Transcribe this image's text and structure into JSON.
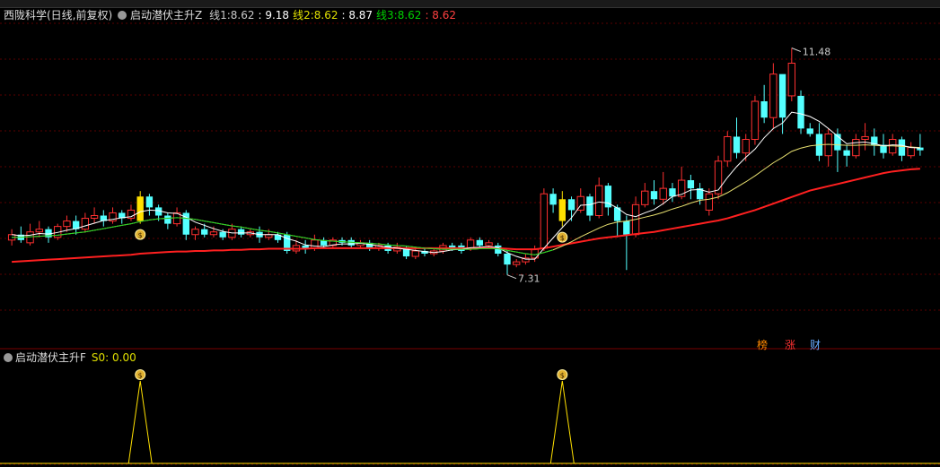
{
  "stock": "西陇科学(日线,前复权)",
  "indicator": "启动潜伏主升Z",
  "lines": [
    {
      "label": "线1:",
      "value": "8.62",
      "color": "#c8c8c8"
    },
    {
      "label": "",
      "value": "9.18",
      "color": "#ffffff"
    },
    {
      "label": "线2:",
      "value": "8.62",
      "color": "#e0e000"
    },
    {
      "label": "",
      "value": "8.87",
      "color": "#ffffff"
    },
    {
      "label": "线3:",
      "value": "8.62",
      "color": "#00d000"
    },
    {
      "label": "",
      "value": "8.62",
      "color": "#ff4040"
    }
  ],
  "sub_indicator": "启动潜伏主升F",
  "sub_value": "S0: 0.00",
  "tags": [
    {
      "text": "榜",
      "color": "#ff8800"
    },
    {
      "text": "涨",
      "color": "#ff3333"
    },
    {
      "text": "财",
      "color": "#66aaff"
    }
  ],
  "chart_data": {
    "type": "candlestick",
    "ylim": [
      6.3,
      11.9
    ],
    "high_label": "11.48",
    "low_label": "7.31",
    "signal_days": [
      14,
      60
    ],
    "candles": [
      [
        7.95,
        8.05,
        8.15,
        7.85
      ],
      [
        8.05,
        7.95,
        8.2,
        7.9
      ],
      [
        7.9,
        8.1,
        8.25,
        7.85
      ],
      [
        8.1,
        8.15,
        8.3,
        8.0
      ],
      [
        8.15,
        8.0,
        8.2,
        7.9
      ],
      [
        8.0,
        8.2,
        8.25,
        7.95
      ],
      [
        8.2,
        8.3,
        8.4,
        8.1
      ],
      [
        8.3,
        8.15,
        8.4,
        8.05
      ],
      [
        8.15,
        8.35,
        8.45,
        8.1
      ],
      [
        8.35,
        8.4,
        8.55,
        8.25
      ],
      [
        8.4,
        8.3,
        8.5,
        8.2
      ],
      [
        8.3,
        8.45,
        8.55,
        8.25
      ],
      [
        8.45,
        8.35,
        8.5,
        8.25
      ],
      [
        8.35,
        8.5,
        8.6,
        8.3
      ],
      [
        8.3,
        8.75,
        8.85,
        8.25
      ],
      [
        8.75,
        8.55,
        8.8,
        8.4
      ],
      [
        8.55,
        8.4,
        8.6,
        8.3
      ],
      [
        8.4,
        8.25,
        8.45,
        8.15
      ],
      [
        8.25,
        8.45,
        8.55,
        8.2
      ],
      [
        8.45,
        8.05,
        8.5,
        7.95
      ],
      [
        8.05,
        8.15,
        8.2,
        7.95
      ],
      [
        8.15,
        8.05,
        8.25,
        8.0
      ],
      [
        8.05,
        8.1,
        8.2,
        8.0
      ],
      [
        8.1,
        8.0,
        8.15,
        7.95
      ],
      [
        8.0,
        8.15,
        8.25,
        7.95
      ],
      [
        8.15,
        8.05,
        8.2,
        8.0
      ],
      [
        8.05,
        8.1,
        8.15,
        8.0
      ],
      [
        8.1,
        8.0,
        8.2,
        7.9
      ],
      [
        8.0,
        8.05,
        8.15,
        7.95
      ],
      [
        8.05,
        7.95,
        8.1,
        7.9
      ],
      [
        8.05,
        7.75,
        8.1,
        7.7
      ],
      [
        7.75,
        7.85,
        7.95,
        7.7
      ],
      [
        7.85,
        7.8,
        7.95,
        7.7
      ],
      [
        7.8,
        7.95,
        8.05,
        7.75
      ],
      [
        7.95,
        7.85,
        8.0,
        7.8
      ],
      [
        7.85,
        7.95,
        8.0,
        7.8
      ],
      [
        7.95,
        7.9,
        8.0,
        7.85
      ],
      [
        7.95,
        7.85,
        8.0,
        7.8
      ],
      [
        7.85,
        7.9,
        7.95,
        7.8
      ],
      [
        7.9,
        7.8,
        7.95,
        7.75
      ],
      [
        7.8,
        7.85,
        7.9,
        7.75
      ],
      [
        7.85,
        7.75,
        7.9,
        7.7
      ],
      [
        7.75,
        7.82,
        7.9,
        7.7
      ],
      [
        7.8,
        7.65,
        7.85,
        7.6
      ],
      [
        7.65,
        7.75,
        7.8,
        7.6
      ],
      [
        7.75,
        7.7,
        7.8,
        7.65
      ],
      [
        7.7,
        7.75,
        7.8,
        7.65
      ],
      [
        7.75,
        7.85,
        7.9,
        7.7
      ],
      [
        7.85,
        7.8,
        7.9,
        7.75
      ],
      [
        7.85,
        7.75,
        7.9,
        7.7
      ],
      [
        7.8,
        7.95,
        8.0,
        7.75
      ],
      [
        7.95,
        7.85,
        8.0,
        7.8
      ],
      [
        7.85,
        7.9,
        7.95,
        7.8
      ],
      [
        7.85,
        7.7,
        7.9,
        7.65
      ],
      [
        7.7,
        7.5,
        7.75,
        7.31
      ],
      [
        7.5,
        7.55,
        7.6,
        7.45
      ],
      [
        7.55,
        7.62,
        7.7,
        7.5
      ],
      [
        7.62,
        7.78,
        7.85,
        7.55
      ],
      [
        7.8,
        8.8,
        8.9,
        7.75
      ],
      [
        8.8,
        8.6,
        8.9,
        8.45
      ],
      [
        8.3,
        8.7,
        8.85,
        8.2
      ],
      [
        8.7,
        8.5,
        8.75,
        8.3
      ],
      [
        8.5,
        8.75,
        8.9,
        8.45
      ],
      [
        8.75,
        8.4,
        8.8,
        8.3
      ],
      [
        8.4,
        8.95,
        9.1,
        8.35
      ],
      [
        8.95,
        8.55,
        9.0,
        8.4
      ],
      [
        8.55,
        8.3,
        8.6,
        8.0
      ],
      [
        8.3,
        8.05,
        8.4,
        7.4
      ],
      [
        8.05,
        8.6,
        8.75,
        8.0
      ],
      [
        8.6,
        8.85,
        9.0,
        8.55
      ],
      [
        8.85,
        8.7,
        9.05,
        8.6
      ],
      [
        8.7,
        8.9,
        9.2,
        8.6
      ],
      [
        8.9,
        8.75,
        9.0,
        8.65
      ],
      [
        8.75,
        9.05,
        9.3,
        8.7
      ],
      [
        9.05,
        8.9,
        9.15,
        8.7
      ],
      [
        8.9,
        8.7,
        9.0,
        8.6
      ],
      [
        8.5,
        8.8,
        8.9,
        8.4
      ],
      [
        8.8,
        9.4,
        9.5,
        8.7
      ],
      [
        9.4,
        9.85,
        9.95,
        9.3
      ],
      [
        9.85,
        9.55,
        10.2,
        9.45
      ],
      [
        9.55,
        9.8,
        9.9,
        9.4
      ],
      [
        9.8,
        10.5,
        10.6,
        9.7
      ],
      [
        10.5,
        10.2,
        10.8,
        10.1
      ],
      [
        10.2,
        11.0,
        11.2,
        10.0
      ],
      [
        11.0,
        10.2,
        10.3,
        9.9
      ],
      [
        10.6,
        11.2,
        11.48,
        10.5
      ],
      [
        10.6,
        10.0,
        10.7,
        9.9
      ],
      [
        10.0,
        9.9,
        10.1,
        9.85
      ],
      [
        9.9,
        9.5,
        10.1,
        9.4
      ],
      [
        9.5,
        9.9,
        10.0,
        9.3
      ],
      [
        9.9,
        9.6,
        10.0,
        9.2
      ],
      [
        9.6,
        9.5,
        9.7,
        9.3
      ],
      [
        9.5,
        9.8,
        9.9,
        9.45
      ],
      [
        9.8,
        9.85,
        10.1,
        9.6
      ],
      [
        9.85,
        9.7,
        10.0,
        9.5
      ],
      [
        9.7,
        9.55,
        9.9,
        9.45
      ],
      [
        9.55,
        9.8,
        9.9,
        9.5
      ],
      [
        9.8,
        9.5,
        9.85,
        9.4
      ],
      [
        9.5,
        9.65,
        9.75,
        9.45
      ],
      [
        9.65,
        9.6,
        9.9,
        9.5
      ]
    ],
    "line_ma_fast": [
      8.05,
      8.03,
      8.04,
      8.07,
      8.06,
      8.09,
      8.13,
      8.16,
      8.21,
      8.26,
      8.31,
      8.33,
      8.36,
      8.38,
      8.47,
      8.5,
      8.49,
      8.45,
      8.44,
      8.37,
      8.28,
      8.22,
      8.16,
      8.11,
      8.08,
      8.08,
      8.08,
      8.05,
      8.05,
      8.05,
      7.98,
      7.93,
      7.86,
      7.84,
      7.83,
      7.86,
      7.88,
      7.88,
      7.89,
      7.87,
      7.84,
      7.82,
      7.8,
      7.78,
      7.76,
      7.74,
      7.72,
      7.74,
      7.77,
      7.78,
      7.81,
      7.82,
      7.83,
      7.81,
      7.72,
      7.65,
      7.6,
      7.6,
      7.8,
      7.99,
      8.18,
      8.36,
      8.59,
      8.6,
      8.65,
      8.63,
      8.54,
      8.42,
      8.38,
      8.45,
      8.51,
      8.62,
      8.75,
      8.79,
      8.87,
      8.88,
      8.83,
      8.87,
      9.1,
      9.3,
      9.47,
      9.62,
      9.83,
      10.0,
      10.1,
      10.3,
      10.27,
      10.22,
      10.13,
      10.0,
      9.86,
      9.72,
      9.74,
      9.75,
      9.72,
      9.68,
      9.7,
      9.69,
      9.65,
      9.64
    ],
    "line_ma_slow": [
      8.0,
      8.0,
      8.01,
      8.02,
      8.03,
      8.04,
      8.06,
      8.08,
      8.1,
      8.13,
      8.16,
      8.19,
      8.22,
      8.25,
      8.29,
      8.32,
      8.34,
      8.35,
      8.36,
      8.35,
      8.33,
      8.3,
      8.27,
      8.24,
      8.21,
      8.19,
      8.16,
      8.13,
      8.11,
      8.08,
      8.05,
      8.02,
      7.99,
      7.96,
      7.94,
      7.93,
      7.92,
      7.91,
      7.9,
      7.89,
      7.88,
      7.86,
      7.85,
      7.84,
      7.82,
      7.8,
      7.79,
      7.78,
      7.78,
      7.78,
      7.78,
      7.79,
      7.79,
      7.79,
      7.76,
      7.73,
      7.7,
      7.68,
      7.72,
      7.77,
      7.84,
      7.92,
      8.01,
      8.09,
      8.17,
      8.24,
      8.28,
      8.3,
      8.33,
      8.37,
      8.41,
      8.46,
      8.52,
      8.57,
      8.63,
      8.68,
      8.7,
      8.74,
      8.82,
      8.92,
      9.02,
      9.13,
      9.25,
      9.37,
      9.47,
      9.58,
      9.64,
      9.68,
      9.7,
      9.71,
      9.7,
      9.69,
      9.69,
      9.7,
      9.69,
      9.68,
      9.68,
      9.67,
      9.66,
      9.65
    ],
    "line_long": [
      7.55,
      7.56,
      7.57,
      7.58,
      7.59,
      7.6,
      7.61,
      7.62,
      7.63,
      7.64,
      7.65,
      7.66,
      7.67,
      7.68,
      7.7,
      7.71,
      7.72,
      7.73,
      7.74,
      7.74,
      7.75,
      7.75,
      7.76,
      7.76,
      7.77,
      7.77,
      7.78,
      7.78,
      7.79,
      7.79,
      7.79,
      7.79,
      7.79,
      7.8,
      7.8,
      7.8,
      7.8,
      7.8,
      7.8,
      7.8,
      7.8,
      7.8,
      7.8,
      7.8,
      7.8,
      7.8,
      7.8,
      7.8,
      7.8,
      7.8,
      7.8,
      7.8,
      7.8,
      7.8,
      7.79,
      7.78,
      7.78,
      7.78,
      7.8,
      7.83,
      7.86,
      7.89,
      7.92,
      7.95,
      7.98,
      8.0,
      8.02,
      8.04,
      8.06,
      8.08,
      8.1,
      8.13,
      8.16,
      8.19,
      8.22,
      8.25,
      8.28,
      8.31,
      8.35,
      8.4,
      8.45,
      8.5,
      8.56,
      8.62,
      8.68,
      8.74,
      8.8,
      8.86,
      8.9,
      8.94,
      8.98,
      9.02,
      9.06,
      9.1,
      9.14,
      9.18,
      9.21,
      9.23,
      9.25,
      9.26
    ]
  }
}
